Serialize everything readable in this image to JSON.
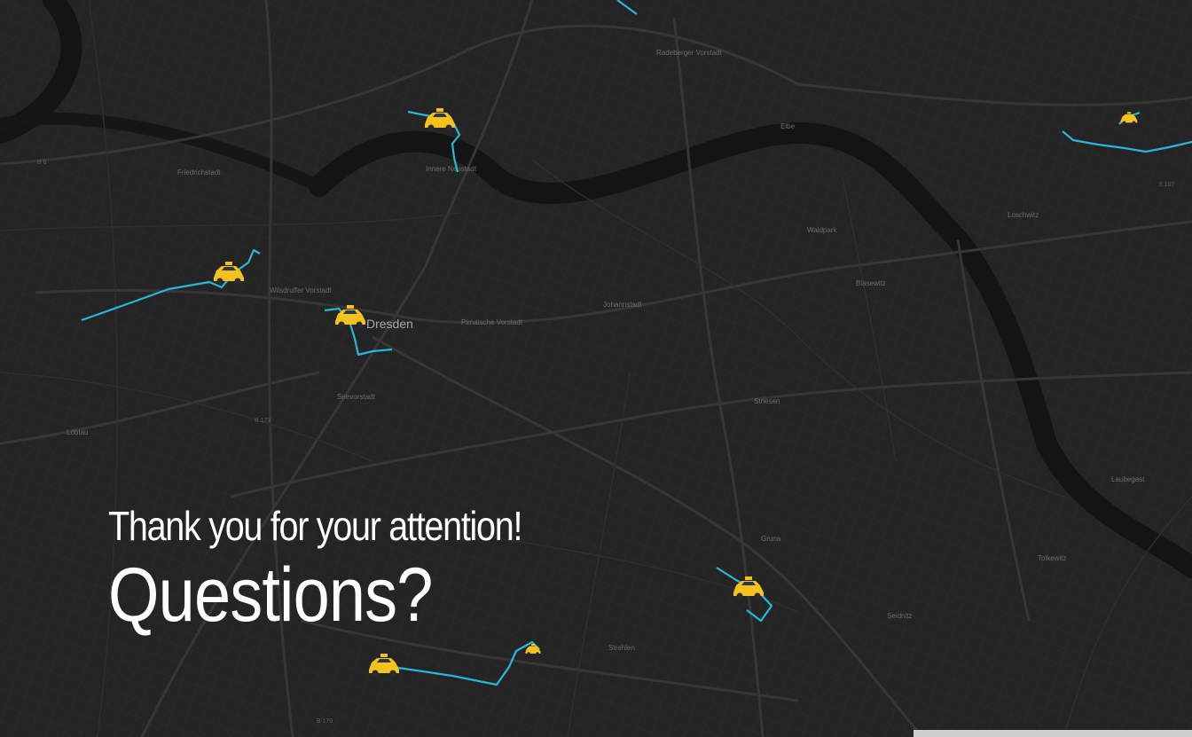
{
  "slide": {
    "line1": "Thank you for your attention!",
    "line2": "Questions?"
  },
  "map": {
    "city_label": "Dresden",
    "labels": [
      {
        "id": "neustadt",
        "text": "Innere Neustadt"
      },
      {
        "id": "radeberger",
        "text": "Radeberger Vorstadt"
      },
      {
        "id": "friedrichstadt",
        "text": "Friedrichstadt"
      },
      {
        "id": "wilsdruffer",
        "text": "Wilsdruffer Vorstadt"
      },
      {
        "id": "pirnaische",
        "text": "Pirnaische Vorstadt"
      },
      {
        "id": "seevorstadt",
        "text": "Seevorstadt"
      },
      {
        "id": "johannstadt",
        "text": "Johannstadt"
      },
      {
        "id": "striesen",
        "text": "Striesen"
      },
      {
        "id": "blasewitz",
        "text": "Blasewitz"
      },
      {
        "id": "loschwitz",
        "text": "Loschwitz"
      },
      {
        "id": "tolkewitz",
        "text": "Tolkewitz"
      },
      {
        "id": "gruna",
        "text": "Gruna"
      },
      {
        "id": "seidnitz",
        "text": "Seidnitz"
      },
      {
        "id": "strehlen",
        "text": "Strehlen"
      },
      {
        "id": "loebtau",
        "text": "Löbtau"
      },
      {
        "id": "waldpark",
        "text": "Waldpark"
      },
      {
        "id": "laubegast",
        "text": "Laubegast"
      },
      {
        "id": "elbe",
        "text": "Elbe"
      },
      {
        "id": "b6",
        "text": "B 6"
      },
      {
        "id": "b173",
        "text": "B 173"
      },
      {
        "id": "b170",
        "text": "B 170"
      },
      {
        "id": "s167",
        "text": "S 167"
      }
    ],
    "colors": {
      "background": "#242424",
      "river": "#121212",
      "road": "#333333",
      "route": "#29b8d8",
      "taxi": "#f3c21f"
    },
    "marker_icon": "taxi-icon"
  }
}
